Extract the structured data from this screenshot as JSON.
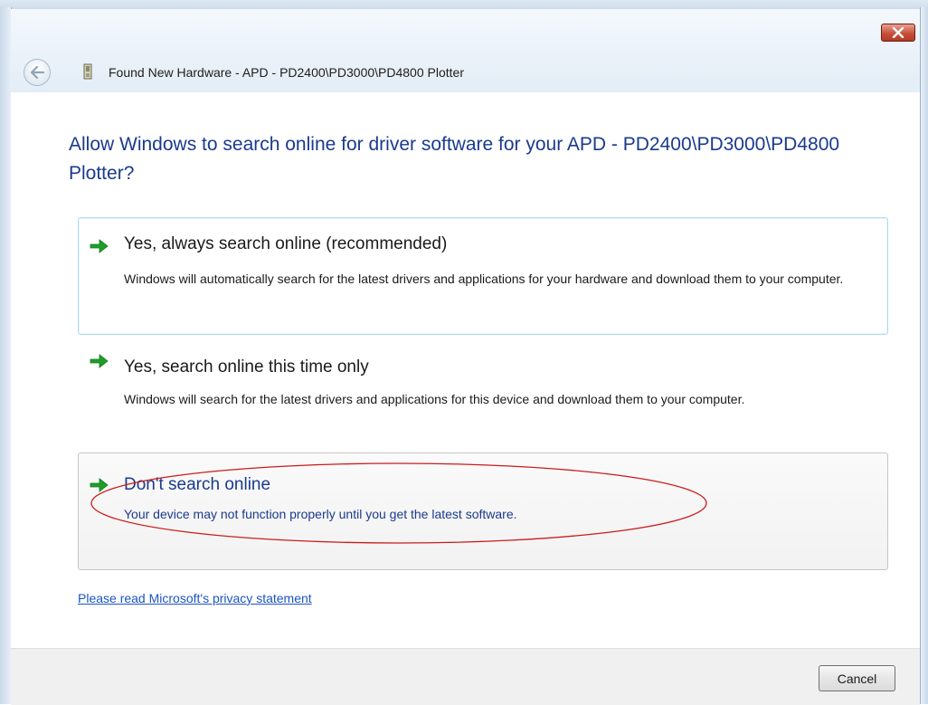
{
  "window": {
    "title": "Found New Hardware - APD - PD2400\\PD3000\\PD4800 Plotter"
  },
  "question": "Allow Windows to search online for driver software for your APD - PD2400\\PD3000\\PD4800 Plotter?",
  "options": [
    {
      "title": "Yes, always search online (recommended)",
      "description": "Windows will automatically search for the latest drivers and applications for your hardware and download them to your computer."
    },
    {
      "title": "Yes, search online this time only",
      "description": "Windows will search for the latest drivers and applications for this device and download them to your computer."
    },
    {
      "title": "Don't search online",
      "description": "Your device may not function properly until you get the latest software."
    }
  ],
  "privacy_link": "Please read Microsoft's  privacy statement",
  "buttons": {
    "cancel": "Cancel"
  },
  "icons": {
    "back": "back-arrow-icon",
    "close": "close-icon",
    "device": "hardware-device-icon",
    "option_arrow": "green-arrow-icon"
  },
  "colors": {
    "heading": "#1a3a8e",
    "link": "#1b55c2",
    "arrow": "#1e9e2a",
    "annotation": "#cc1b1b"
  }
}
